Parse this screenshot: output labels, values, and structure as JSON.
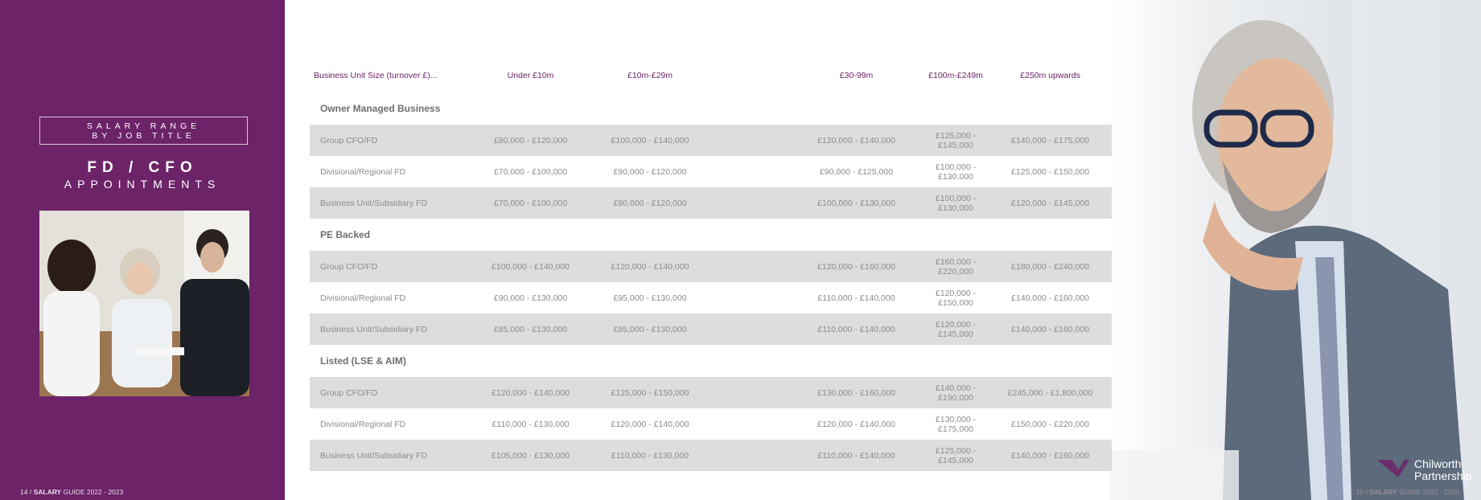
{
  "left_panel": {
    "box_line1": "SALARY RANGE",
    "box_line2": "BY JOB TITLE",
    "title": "FD / CFO",
    "subtitle": "APPOINTMENTS",
    "footer_page": "14 /",
    "footer_bold": "SALARY",
    "footer_rest": "GUIDE 2022 - 2023"
  },
  "right_footer": {
    "page": "15 /",
    "bold": "SALARY",
    "rest": "GUIDE 2022 - 2023"
  },
  "logo": {
    "line1": "Chilworth",
    "line2": "Partnership",
    "color": "#6c2368"
  },
  "table": {
    "headers": [
      "Business Unit Size (turnover £)...",
      "Under £10m",
      "£10m-£29m",
      "£30-99m",
      "£100m-£249m",
      "£250m upwards"
    ],
    "sections": [
      {
        "name": "Owner Managed Business",
        "rows": [
          [
            "Group CFO/FD",
            "£80,000 - £120,000",
            "£100,000 - £140,000",
            "£120,000 - £140,000",
            "£125,000 - £145,000",
            "£140,000 - £175,000"
          ],
          [
            "Divisional/Regional FD",
            "£70,000 - £100,000",
            "£90,000 - £120,000",
            "£90,000 - £125,000",
            "£100,000 - £130,000",
            "£125,000 - £150,000"
          ],
          [
            "Business Unit/Subsidiary FD",
            "£70,000 - £100,000",
            "£90,000 - £120,000",
            "£100,000 - £130,000",
            "£100,000 - £130,000",
            "£120,000 - £145,000"
          ]
        ]
      },
      {
        "name": "PE Backed",
        "rows": [
          [
            "Group CFO/FD",
            "£100,000 - £140,000",
            "£120,000 - £140,000",
            "£120,000 - £160,000",
            "£160,000 - £220,000",
            "£180,000 - £240,000"
          ],
          [
            "Divisional/Regional FD",
            "£90,000 - £130,000",
            "£95,000 - £130,000",
            "£110,000 - £140,000",
            "£120,000 - £150,000",
            "£140,000 - £160,000"
          ],
          [
            "Business Unit/Subsidiary FD",
            "£85,000 - £130,000",
            "£95,000 - £130,000",
            "£110,000 - £140,000",
            "£120,000 - £145,000",
            "£140,000 - £160,000"
          ]
        ]
      },
      {
        "name": "Listed (LSE & AIM)",
        "rows": [
          [
            "Group CFO/FD",
            "£120,000 - £140,000",
            "£125,000 - £150,000",
            "£130,000 - £160,000",
            "£140,000 - £190,000",
            "£245,000 - £1,800,000"
          ],
          [
            "Divisional/Regional FD",
            "£110,000 - £130,000",
            "£120,000 - £140,000",
            "£120,000 - £140,000",
            "£130,000 - £175,000",
            "£150,000 - £220,000"
          ],
          [
            "Business Unit/Subsidiary FD",
            "£105,000 - £130,000",
            "£110,000 - £130,000",
            "£110,000 - £140,000",
            "£125,000 - £145,000",
            "£140,000 - £160,000"
          ]
        ]
      }
    ]
  },
  "colors": {
    "brand_purple": "#6c2368",
    "row_shade": "#d2d2d2",
    "body_text": "#8b8b8b"
  }
}
